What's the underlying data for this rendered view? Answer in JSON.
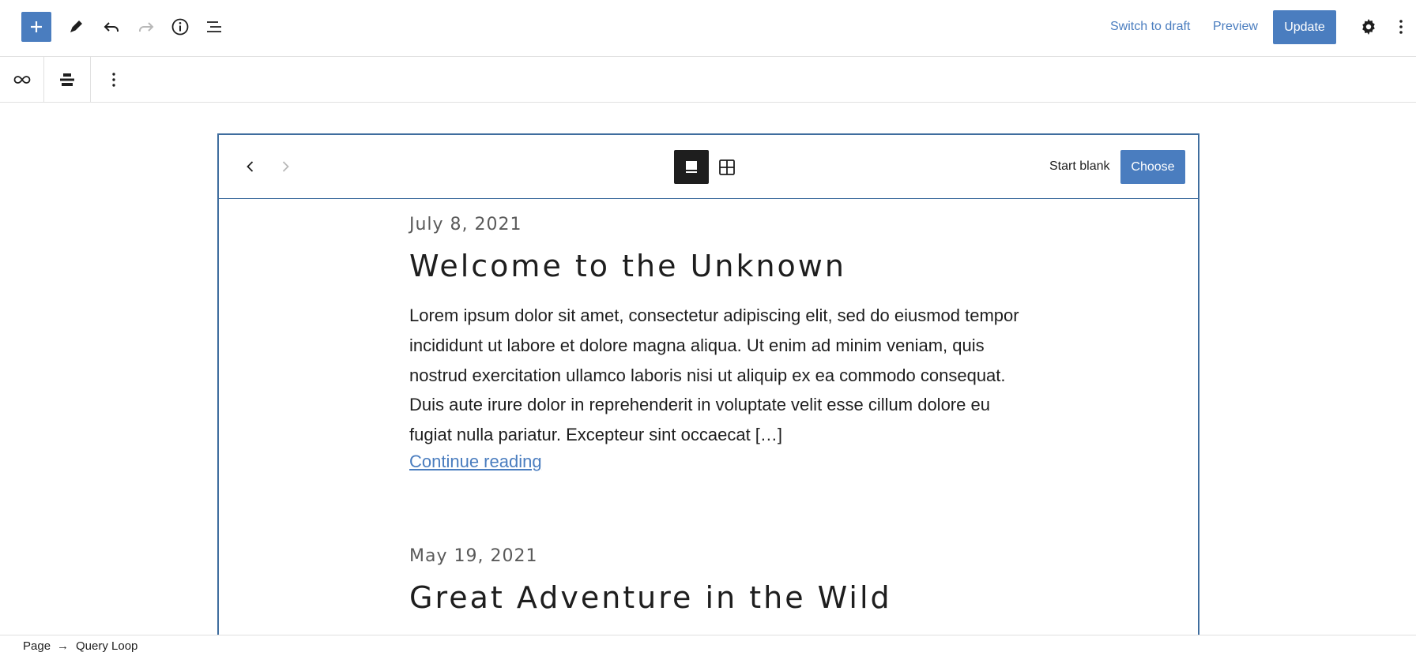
{
  "topbar": {
    "inserter_icon": "plus-icon",
    "tools_icon": "pencil-icon",
    "undo_icon": "undo-icon",
    "redo_icon": "redo-icon",
    "info_icon": "info-icon",
    "outline_icon": "list-view-icon",
    "switch_to_draft": "Switch to draft",
    "preview": "Preview",
    "update": "Update",
    "settings_icon": "gear-icon",
    "options_icon": "more-vertical-icon",
    "accent": "#4a7dbf"
  },
  "block_toolbar": {
    "block_icon": "loop-icon",
    "align_icon": "align-center-icon",
    "options_icon": "more-vertical-icon"
  },
  "pattern_toolbar": {
    "prev_icon": "chevron-left-icon",
    "next_icon": "chevron-right-icon",
    "carousel_view_icon": "carousel-icon",
    "grid_view_icon": "grid-icon",
    "start_blank": "Start blank",
    "choose": "Choose"
  },
  "posts": [
    {
      "date": "July 8, 2021",
      "title": "Welcome to the Unknown",
      "excerpt": "Lorem ipsum dolor sit amet, consectetur adipiscing elit, sed do eiusmod tempor incididunt ut labore et dolore magna aliqua. Ut enim ad minim veniam, quis nostrud exercitation ullamco laboris nisi ut aliquip ex ea commodo consequat. Duis aute irure dolor in reprehenderit in voluptate velit esse cillum dolore eu fugiat nulla pariatur. Excepteur sint occaecat […]",
      "continue": "Continue reading"
    },
    {
      "date": "May 19, 2021",
      "title": "Great Adventure in the Wild"
    }
  ],
  "breadcrumb": {
    "items": [
      "Page",
      "Query Loop"
    ],
    "separator": "→"
  }
}
